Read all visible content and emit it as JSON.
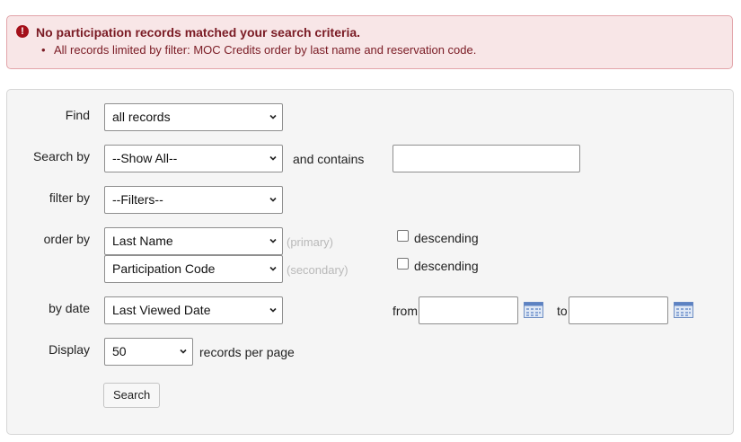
{
  "alert": {
    "icon": "exclamation-circle-icon",
    "title": "No participation records matched your search criteria.",
    "items": [
      "All records limited by filter: MOC Credits order by last name and reservation code."
    ],
    "colors": {
      "background": "#f8e6e7",
      "border": "#e2a4a9",
      "text": "#7a1b24",
      "icon": "#a4101a"
    }
  },
  "form": {
    "find": {
      "label": "Find",
      "value": "all records"
    },
    "search_by": {
      "label": "Search by",
      "value": "--Show All--",
      "contains_label": "and contains",
      "contains_value": ""
    },
    "filter_by": {
      "label": "filter by",
      "value": "--Filters--"
    },
    "order_by": {
      "label": "order by",
      "primary": {
        "value": "Last Name",
        "hint": "(primary)",
        "descending_label": "descending",
        "descending_checked": false
      },
      "secondary": {
        "value": "Participation Code",
        "hint": "(secondary)",
        "descending_label": "descending",
        "descending_checked": false
      }
    },
    "by_date": {
      "label": "by date",
      "value": "Last Viewed Date",
      "from_label": "from",
      "from_value": "",
      "to_label": "to",
      "to_value": ""
    },
    "display": {
      "label": "Display",
      "value": "50",
      "suffix": "records per page"
    },
    "search_button": "Search"
  }
}
